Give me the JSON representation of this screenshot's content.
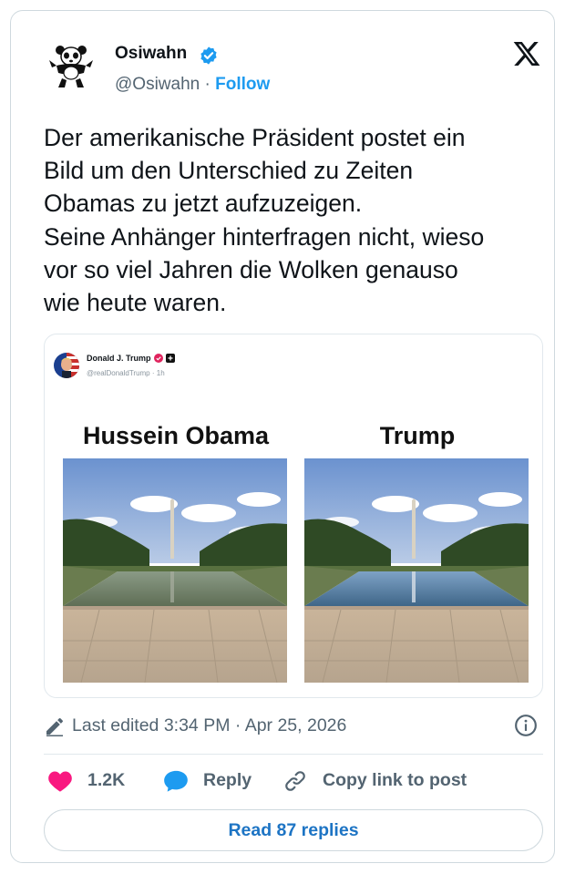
{
  "author": {
    "display_name": "Osiwahn",
    "handle": "@Osiwahn",
    "separator": "·",
    "follow_label": "Follow"
  },
  "tweet": {
    "text": "Der amerikanische Präsident postet ein\nBild um den Unterschied zu Zeiten\nObamas zu jetzt aufzuzeigen.\nSeine Anhänger hinterfragen nicht, wieso\nvor so viel Jahren die Wolken genauso\nwie heute waren."
  },
  "quoted_post": {
    "name": "Donald J. Trump",
    "handle_line": "@realDonaldTrump · 1h",
    "left_title": "Hussein Obama",
    "right_title": "Trump"
  },
  "meta": {
    "edited_text": "Last edited 3:34 PM · Apr 25, 2026"
  },
  "actions": {
    "likes": "1.2K",
    "reply_label": "Reply",
    "copy_label": "Copy link to post"
  },
  "footer": {
    "read_replies": "Read 87 replies"
  },
  "colors": {
    "accent": "#1d9bf0",
    "like": "#f91880",
    "text": "#0f1419",
    "secondary": "#536471",
    "border": "#cfd9de"
  }
}
